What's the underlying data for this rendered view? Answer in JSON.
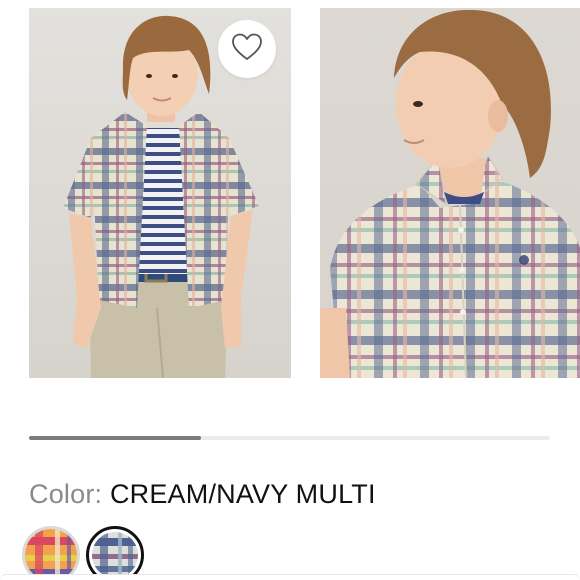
{
  "product": {
    "images": [
      {
        "alt": "Boy wearing plaid short-sleeve shirt, front view"
      },
      {
        "alt": "Boy wearing plaid short-sleeve shirt, side close-up"
      }
    ],
    "favorite_icon": "heart-outline-icon",
    "carousel_progress": 0.33,
    "color": {
      "label": "Color:",
      "value": "CREAM/NAVY MULTI"
    },
    "swatches": [
      {
        "name": "orange-pink plaid",
        "selected": false
      },
      {
        "name": "cream navy plaid",
        "selected": true
      }
    ]
  },
  "colors": {
    "progress_fill": "#7b7b7b",
    "progress_track": "#ececec",
    "label_gray": "#8a8a8a",
    "text_dark": "#111111"
  }
}
